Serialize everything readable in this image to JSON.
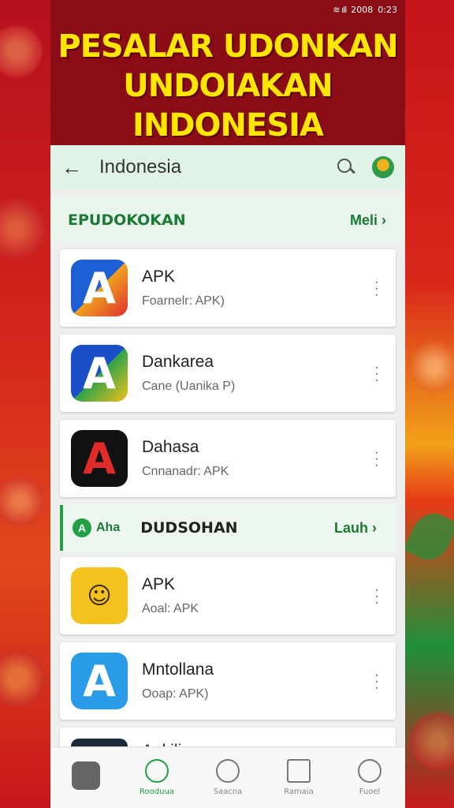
{
  "status_bar": {
    "signal": "≋ ıll",
    "clock": "2008",
    "battery": "0:23"
  },
  "banner": {
    "line1": "PESALAR UDONKAN",
    "line2": "UNDOIAKAN INDONESIA"
  },
  "app_bar": {
    "back": "←",
    "title": "Indonesia"
  },
  "section1": {
    "label": "EPUDOKOKAN",
    "more": "Meli ›"
  },
  "apps_top": [
    {
      "letter": "A",
      "name": "APK",
      "sub": "Foarnelr: APK)"
    },
    {
      "letter": "A",
      "name": "Dankarea",
      "sub": "Cane (Uanika P)"
    },
    {
      "letter": "A",
      "name": "Dahasa",
      "sub": "Cnnanadr: APK"
    }
  ],
  "section2": {
    "tag_icon": "A",
    "tag": "Aha",
    "label": "DUDSOHAN",
    "more": "Lauh ›"
  },
  "apps_bottom": [
    {
      "letter": "☺",
      "name": "APK",
      "sub": "Aoal: APK"
    },
    {
      "letter": "A",
      "name": "Mntollana",
      "sub": "Ooap: APK)"
    },
    {
      "letter": "",
      "name": "Ankilicoan",
      "sub": ""
    }
  ],
  "bottom_nav": [
    {
      "label": ""
    },
    {
      "label": "Rooduua"
    },
    {
      "label": "Saacna"
    },
    {
      "label": "Ramaia"
    },
    {
      "label": "Fuoel"
    }
  ]
}
